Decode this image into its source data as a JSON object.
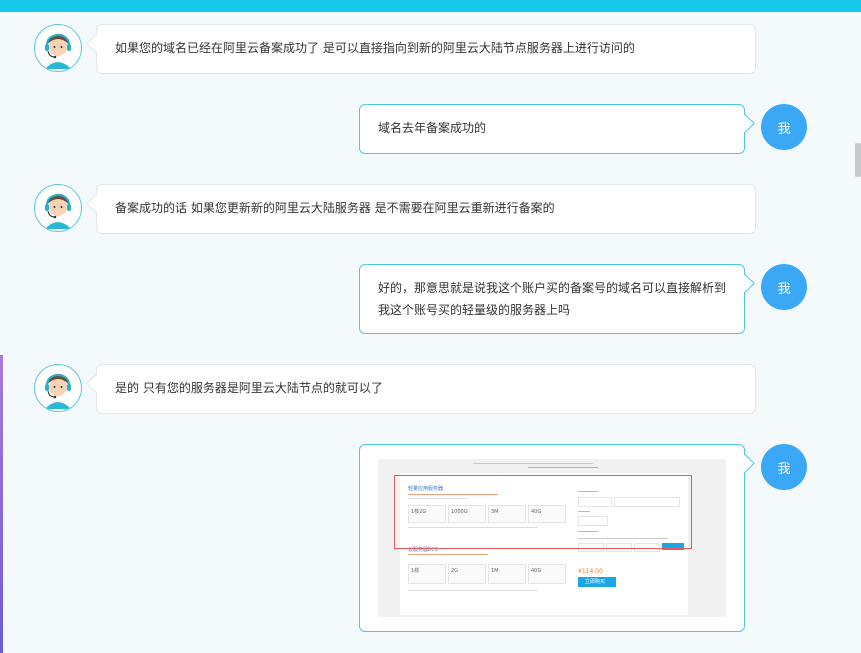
{
  "window": {
    "accent": "#16c8ea",
    "avatar_me_color": "#3aa8f5"
  },
  "messages": [
    {
      "sender": "agent",
      "text": "如果您的域名已经在阿里云备案成功了 是可以直接指向到新的阿里云大陆节点服务器上进行访问的"
    },
    {
      "sender": "me",
      "avatar_label": "我",
      "text": "域名去年备案成功的"
    },
    {
      "sender": "agent",
      "text": "备案成功的话 如果您更新新的阿里云大陆服务器 是不需要在阿里云重新进行备案的"
    },
    {
      "sender": "me",
      "avatar_label": "我",
      "text": "好的，那意思就是说我这个账户买的备案号的域名可以直接解析到我这个账号买的轻量级的服务器上吗"
    },
    {
      "sender": "agent",
      "text": "是的 只有您的服务器是阿里云大陆节点的就可以了"
    },
    {
      "sender": "me",
      "avatar_label": "我",
      "type": "image",
      "image": {
        "card1_title": "轻量应用服务器",
        "card2_title": "云服务器ECS",
        "specs1": [
          "1核2G",
          "1000G",
          "3M",
          "40G"
        ],
        "specs2": [
          "1核",
          "2G",
          "1M",
          "40G"
        ],
        "price": "¥114.00",
        "buy_label": "立即购买"
      }
    }
  ],
  "icons": {
    "agent_avatar": "customer-service-avatar-icon"
  }
}
